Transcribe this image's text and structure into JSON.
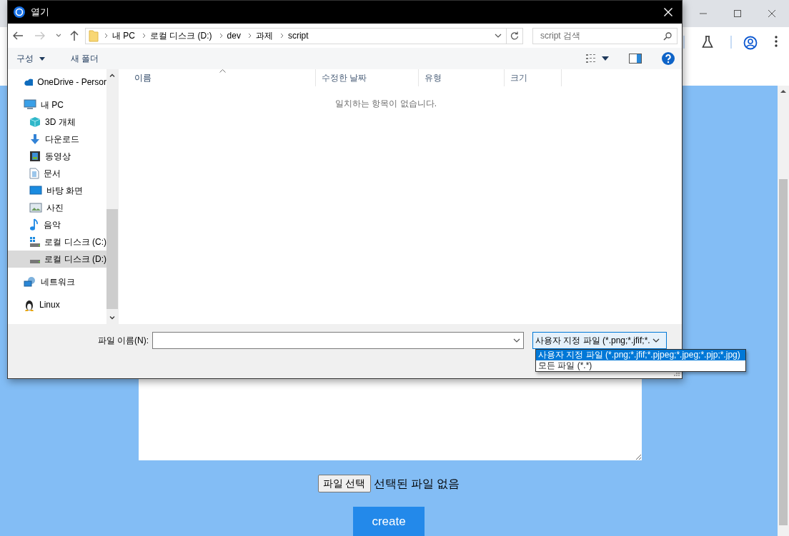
{
  "dialog": {
    "title": "열기",
    "back": {
      "disabled": false
    },
    "forward": {
      "disabled": true
    },
    "path": [
      "내 PC",
      "로컬 디스크 (D:)",
      "dev",
      "과제",
      "script"
    ],
    "search": {
      "placeholder": "script 검색"
    },
    "commands": [
      {
        "label": "구성",
        "kind": "menu"
      },
      {
        "label": "새 폴더",
        "kind": "button"
      }
    ],
    "nav": [
      {
        "label": "OneDrive - Persor",
        "kind": "cloud",
        "selected": false
      },
      {
        "label": "내 PC",
        "kind": "computer",
        "selected": false,
        "children": [
          {
            "label": "3D 개체",
            "kind": "cube",
            "selected": false
          },
          {
            "label": "다운로드",
            "kind": "download",
            "selected": false
          },
          {
            "label": "동영상",
            "kind": "video",
            "selected": false
          },
          {
            "label": "문서",
            "kind": "document",
            "selected": false
          },
          {
            "label": "바탕 화면",
            "kind": "desktop",
            "selected": false
          },
          {
            "label": "사진",
            "kind": "photo",
            "selected": false
          },
          {
            "label": "음악",
            "kind": "music",
            "selected": false
          },
          {
            "label": "로컬 디스크 (C:)",
            "kind": "systemdrive",
            "selected": false
          },
          {
            "label": "로컬 디스크 (D:)",
            "kind": "drive",
            "selected": true
          }
        ]
      },
      {
        "label": "네트워크",
        "kind": "network",
        "selected": false
      },
      {
        "label": "Linux",
        "kind": "penguin",
        "selected": false
      }
    ],
    "columns": [
      {
        "label": "이름",
        "sorted": true
      },
      {
        "label": "수정한 날짜",
        "sorted": false
      },
      {
        "label": "유형",
        "sorted": false
      },
      {
        "label": "크기",
        "sorted": false
      }
    ],
    "empty_message": "일치하는 항목이 없습니다.",
    "file_name": {
      "label": "파일 이름(N):"
    },
    "filter": {
      "value": "사용자 지정 파일 (*.png;*.jfif;*.",
      "options": [
        {
          "label": "사용자 지정 파일 (*.png;*.jfif;*.pjpeg;*.jpeg;*.pjp;*.jpg)",
          "selected": true
        },
        {
          "label": "모든 파일 (*.*)",
          "selected": false
        }
      ]
    }
  },
  "page": {
    "file_button": "파일 선택",
    "file_status": "선택된 파일 없음",
    "submit": "create"
  }
}
